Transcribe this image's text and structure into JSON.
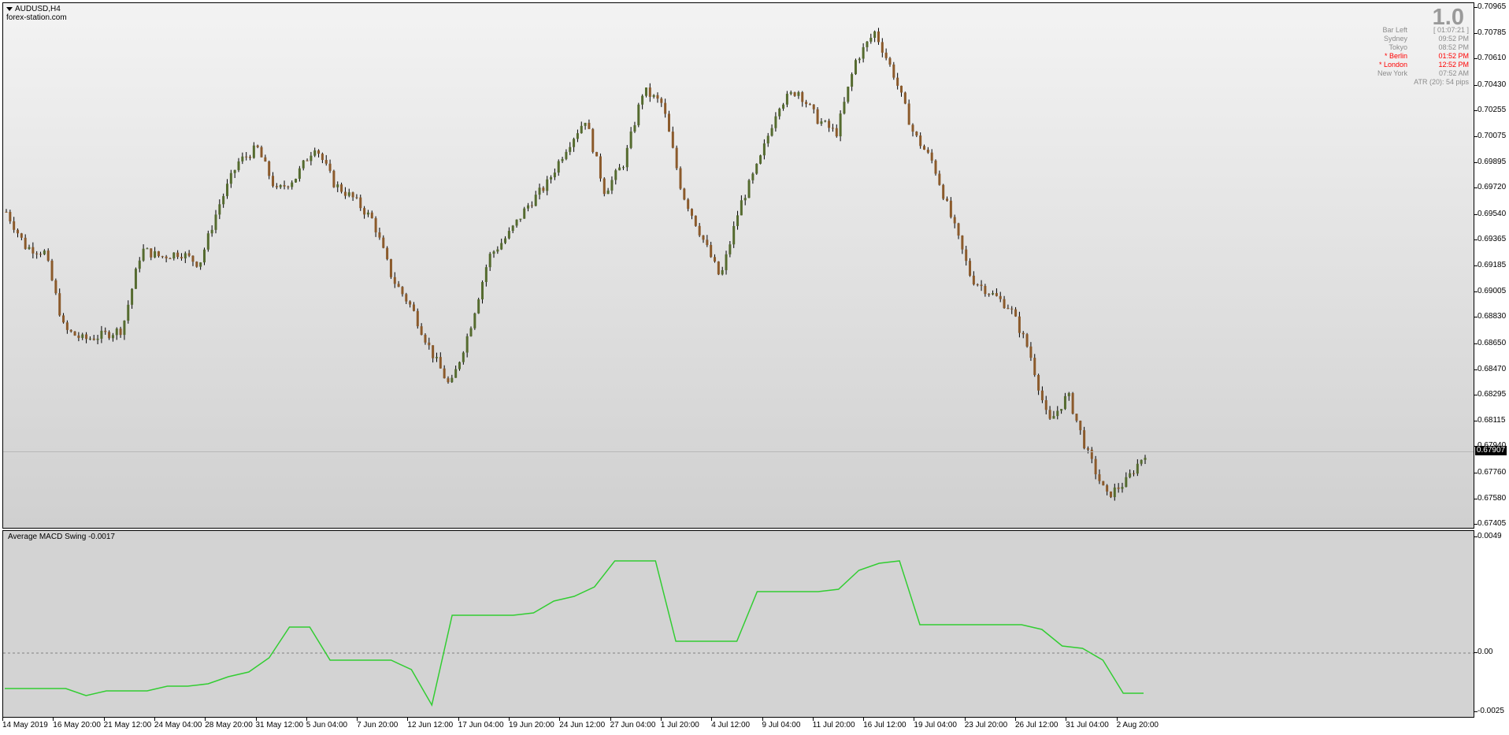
{
  "chart": {
    "symbol": "AUDUSD,H4",
    "website": "forex-station.com",
    "big_number": "1.0",
    "info_panel": {
      "bar_left_label": "Bar Left",
      "bar_left_value": "[ 01:07:21 ]",
      "clocks": [
        {
          "city": "Sydney",
          "time": "09:52 PM",
          "highlight": false
        },
        {
          "city": "Tokyo",
          "time": "08:52 PM",
          "highlight": false
        },
        {
          "city": "* Berlin",
          "time": "01:52 PM",
          "highlight": true
        },
        {
          "city": "* London",
          "time": "12:52 PM",
          "highlight": true
        },
        {
          "city": "New York",
          "time": "07:52 AM",
          "highlight": false
        }
      ],
      "atr": "ATR (20): 54 pips"
    },
    "current_price": "0.67907",
    "price_axis": [
      "0.70965",
      "0.70785",
      "0.70610",
      "0.70430",
      "0.70255",
      "0.70075",
      "0.69895",
      "0.69720",
      "0.69540",
      "0.69365",
      "0.69185",
      "0.69005",
      "0.68830",
      "0.68650",
      "0.68470",
      "0.68295",
      "0.68115",
      "0.67940",
      "0.67760",
      "0.67580",
      "0.67405"
    ],
    "colors": {
      "up_candle": "#556b2f",
      "down_candle": "#8b5a2b",
      "wick": "#000000",
      "indicator_line": "#32cd32"
    }
  },
  "indicator": {
    "label": "Average MACD Swing -0.0017",
    "axis": [
      "0.0049",
      "0.00",
      "-0.0025"
    ]
  },
  "time_axis": [
    "14 May 2019",
    "16 May 20:00",
    "21 May 12:00",
    "24 May 04:00",
    "28 May 20:00",
    "31 May 12:00",
    "5 Jun 04:00",
    "7 Jun 20:00",
    "12 Jun 12:00",
    "17 Jun 04:00",
    "19 Jun 20:00",
    "24 Jun 12:00",
    "27 Jun 04:00",
    "1 Jul 20:00",
    "4 Jul 12:00",
    "9 Jul 04:00",
    "11 Jul 20:00",
    "16 Jul 12:00",
    "19 Jul 04:00",
    "23 Jul 20:00",
    "26 Jul 12:00",
    "31 Jul 04:00",
    "2 Aug 20:00"
  ],
  "chart_data": {
    "type": "candlestick",
    "symbol": "AUDUSD",
    "timeframe": "H4",
    "x": [
      "14 May 2019",
      "16 May 20:00",
      "21 May 12:00",
      "24 May 04:00",
      "28 May 20:00",
      "31 May 12:00",
      "5 Jun 04:00",
      "7 Jun 20:00",
      "12 Jun 12:00",
      "17 Jun 04:00",
      "19 Jun 20:00",
      "24 Jun 12:00",
      "27 Jun 04:00",
      "1 Jul 20:00",
      "4 Jul 12:00",
      "9 Jul 04:00",
      "11 Jul 20:00",
      "16 Jul 12:00",
      "19 Jul 04:00",
      "23 Jul 20:00",
      "26 Jul 12:00",
      "31 Jul 04:00",
      "2 Aug 20:00"
    ],
    "close_path": [
      0.6956,
      0.6932,
      0.6928,
      0.6875,
      0.6868,
      0.6871,
      0.6875,
      0.693,
      0.6925,
      0.6928,
      0.692,
      0.696,
      0.699,
      0.7,
      0.697,
      0.698,
      0.7002,
      0.6975,
      0.6965,
      0.695,
      0.691,
      0.689,
      0.686,
      0.6835,
      0.6875,
      0.6925,
      0.694,
      0.696,
      0.6975,
      0.7,
      0.702,
      0.697,
      0.699,
      0.704,
      0.703,
      0.697,
      0.694,
      0.691,
      0.696,
      0.699,
      0.703,
      0.704,
      0.702,
      0.701,
      0.706,
      0.708,
      0.705,
      0.701,
      0.699,
      0.695,
      0.691,
      0.69,
      0.689,
      0.686,
      0.681,
      0.683,
      0.679,
      0.676,
      0.677,
      0.679
    ],
    "ylim": [
      0.67405,
      0.70965
    ],
    "indicator": {
      "name": "Average MACD Swing",
      "current": -0.0017,
      "ylim": [
        -0.0025,
        0.0049
      ],
      "values": [
        -0.0015,
        -0.0015,
        -0.0015,
        -0.0015,
        -0.0018,
        -0.0016,
        -0.0016,
        -0.0016,
        -0.0014,
        -0.0014,
        -0.0013,
        -0.001,
        -0.0008,
        -0.0002,
        0.0011,
        0.0011,
        -0.0003,
        -0.0003,
        -0.0003,
        -0.0003,
        -0.0007,
        -0.0022,
        0.0016,
        0.0016,
        0.0016,
        0.0016,
        0.0017,
        0.0022,
        0.0024,
        0.0028,
        0.0039,
        0.0039,
        0.0039,
        0.0005,
        0.0005,
        0.0005,
        0.0005,
        0.0026,
        0.0026,
        0.0026,
        0.0026,
        0.0027,
        0.0035,
        0.0038,
        0.0039,
        0.0012,
        0.0012,
        0.0012,
        0.0012,
        0.0012,
        0.0012,
        0.001,
        0.0003,
        0.0002,
        -0.0003,
        -0.0017,
        -0.0017
      ]
    }
  }
}
